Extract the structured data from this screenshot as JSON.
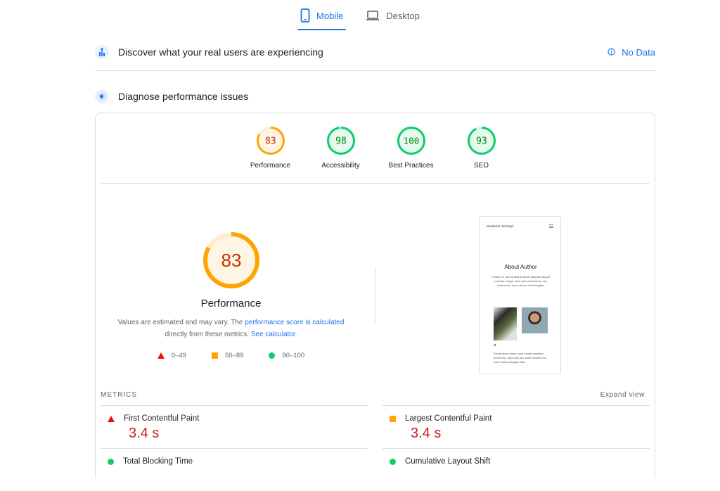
{
  "tabs": [
    {
      "label": "Mobile",
      "icon": "phone-icon",
      "active": true
    },
    {
      "label": "Desktop",
      "icon": "laptop-icon",
      "active": false
    }
  ],
  "field_section": {
    "title": "Discover what your real users are experiencing",
    "icon": "users-chart-icon",
    "status_label": "No Data",
    "status_icon": "info-icon"
  },
  "lab_section": {
    "title": "Diagnose performance issues",
    "icon": "lighthouse-icon"
  },
  "categories": [
    {
      "label": "Performance",
      "score": "83",
      "score_num": 83,
      "rating": "average"
    },
    {
      "label": "Accessibility",
      "score": "98",
      "score_num": 98,
      "rating": "pass"
    },
    {
      "label": "Best Practices",
      "score": "100",
      "score_num": 100,
      "rating": "pass"
    },
    {
      "label": "SEO",
      "score": "93",
      "score_num": 93,
      "rating": "pass"
    }
  ],
  "performance": {
    "score": "83",
    "score_num": 83,
    "title": "Performance",
    "note_prefix": "Values are estimated and may vary. The ",
    "note_link1": "performance score is calculated",
    "note_middle": " directly from these metrics. ",
    "note_link2": "See calculator."
  },
  "legend": [
    {
      "shape": "triangle",
      "label": "0–49"
    },
    {
      "shape": "square",
      "label": "50–89"
    },
    {
      "shape": "circle",
      "label": "90–100"
    }
  ],
  "thumbnail": {
    "site_name": "Mudassar Jehangir",
    "menu_icon": "hamburger-icon",
    "heading": "About Author",
    "paragraph": "Porttitor in nibh id aliquet quam aliquam aliquet pulvinar integer dolor quis elementum, dui cursus nisi, nunc viverra nulla fringilla.",
    "paragraph2": "Elementum neque nulla mauris faucibus lorem nisl, eget quis duo amet lobortis non enim viverra feugiat vitae."
  },
  "metrics": {
    "label": "METRICS",
    "expand_label": "Expand view",
    "items": [
      {
        "name": "First Contentful Paint",
        "value": "3.4 s",
        "rating": "fail"
      },
      {
        "name": "Largest Contentful Paint",
        "value": "3.4 s",
        "rating": "average"
      },
      {
        "name": "Total Blocking Time",
        "value": "",
        "rating": "pass"
      },
      {
        "name": "Cumulative Layout Shift",
        "value": "",
        "rating": "pass"
      }
    ]
  },
  "colors": {
    "accent": "#1a73e8",
    "pass": "#0cce6b",
    "average": "#ffa400",
    "fail": "#eb0f00",
    "average_text": "#c33300",
    "pass_text": "#008800",
    "fail_value": "#c5221f"
  }
}
